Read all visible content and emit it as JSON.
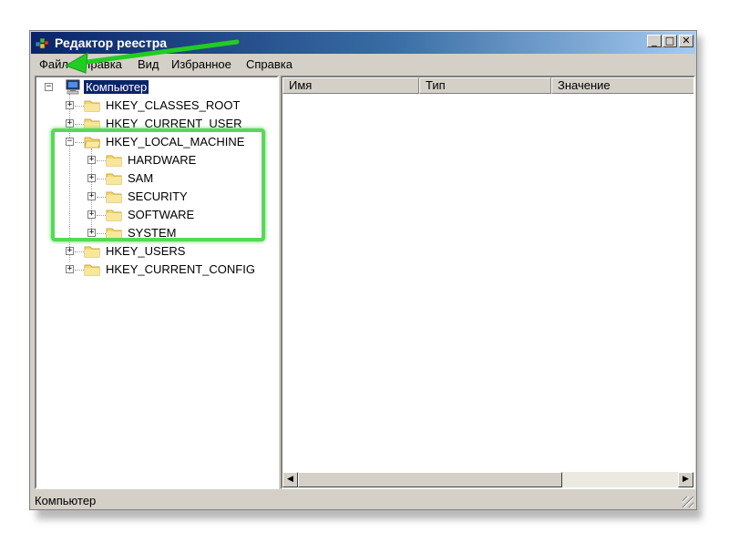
{
  "window": {
    "title": "Редактор реестра",
    "controls": {
      "minimize": "_",
      "maximize": "□",
      "close": "✕"
    }
  },
  "menu": [
    "Файл",
    "Правка",
    "Вид",
    "Избранное",
    "Справка"
  ],
  "tree": {
    "root": "Компьютер",
    "hives": [
      {
        "label": "HKEY_CLASSES_ROOT",
        "expanded": false
      },
      {
        "label": "HKEY_CURRENT_USER",
        "expanded": false
      },
      {
        "label": "HKEY_LOCAL_MACHINE",
        "expanded": true,
        "children": [
          "HARDWARE",
          "SAM",
          "SECURITY",
          "SOFTWARE",
          "SYSTEM"
        ]
      },
      {
        "label": "HKEY_USERS",
        "expanded": false
      },
      {
        "label": "HKEY_CURRENT_CONFIG",
        "expanded": false
      }
    ]
  },
  "list": {
    "columns": [
      "Имя",
      "Тип",
      "Значение"
    ]
  },
  "status": "Компьютер",
  "annotation": {
    "highlight_color": "#58d858",
    "arrow_color": "#22cc22"
  },
  "icons": {
    "app": "registry-editor-icon",
    "computer": "computer-icon",
    "folder": "folder-icon"
  }
}
